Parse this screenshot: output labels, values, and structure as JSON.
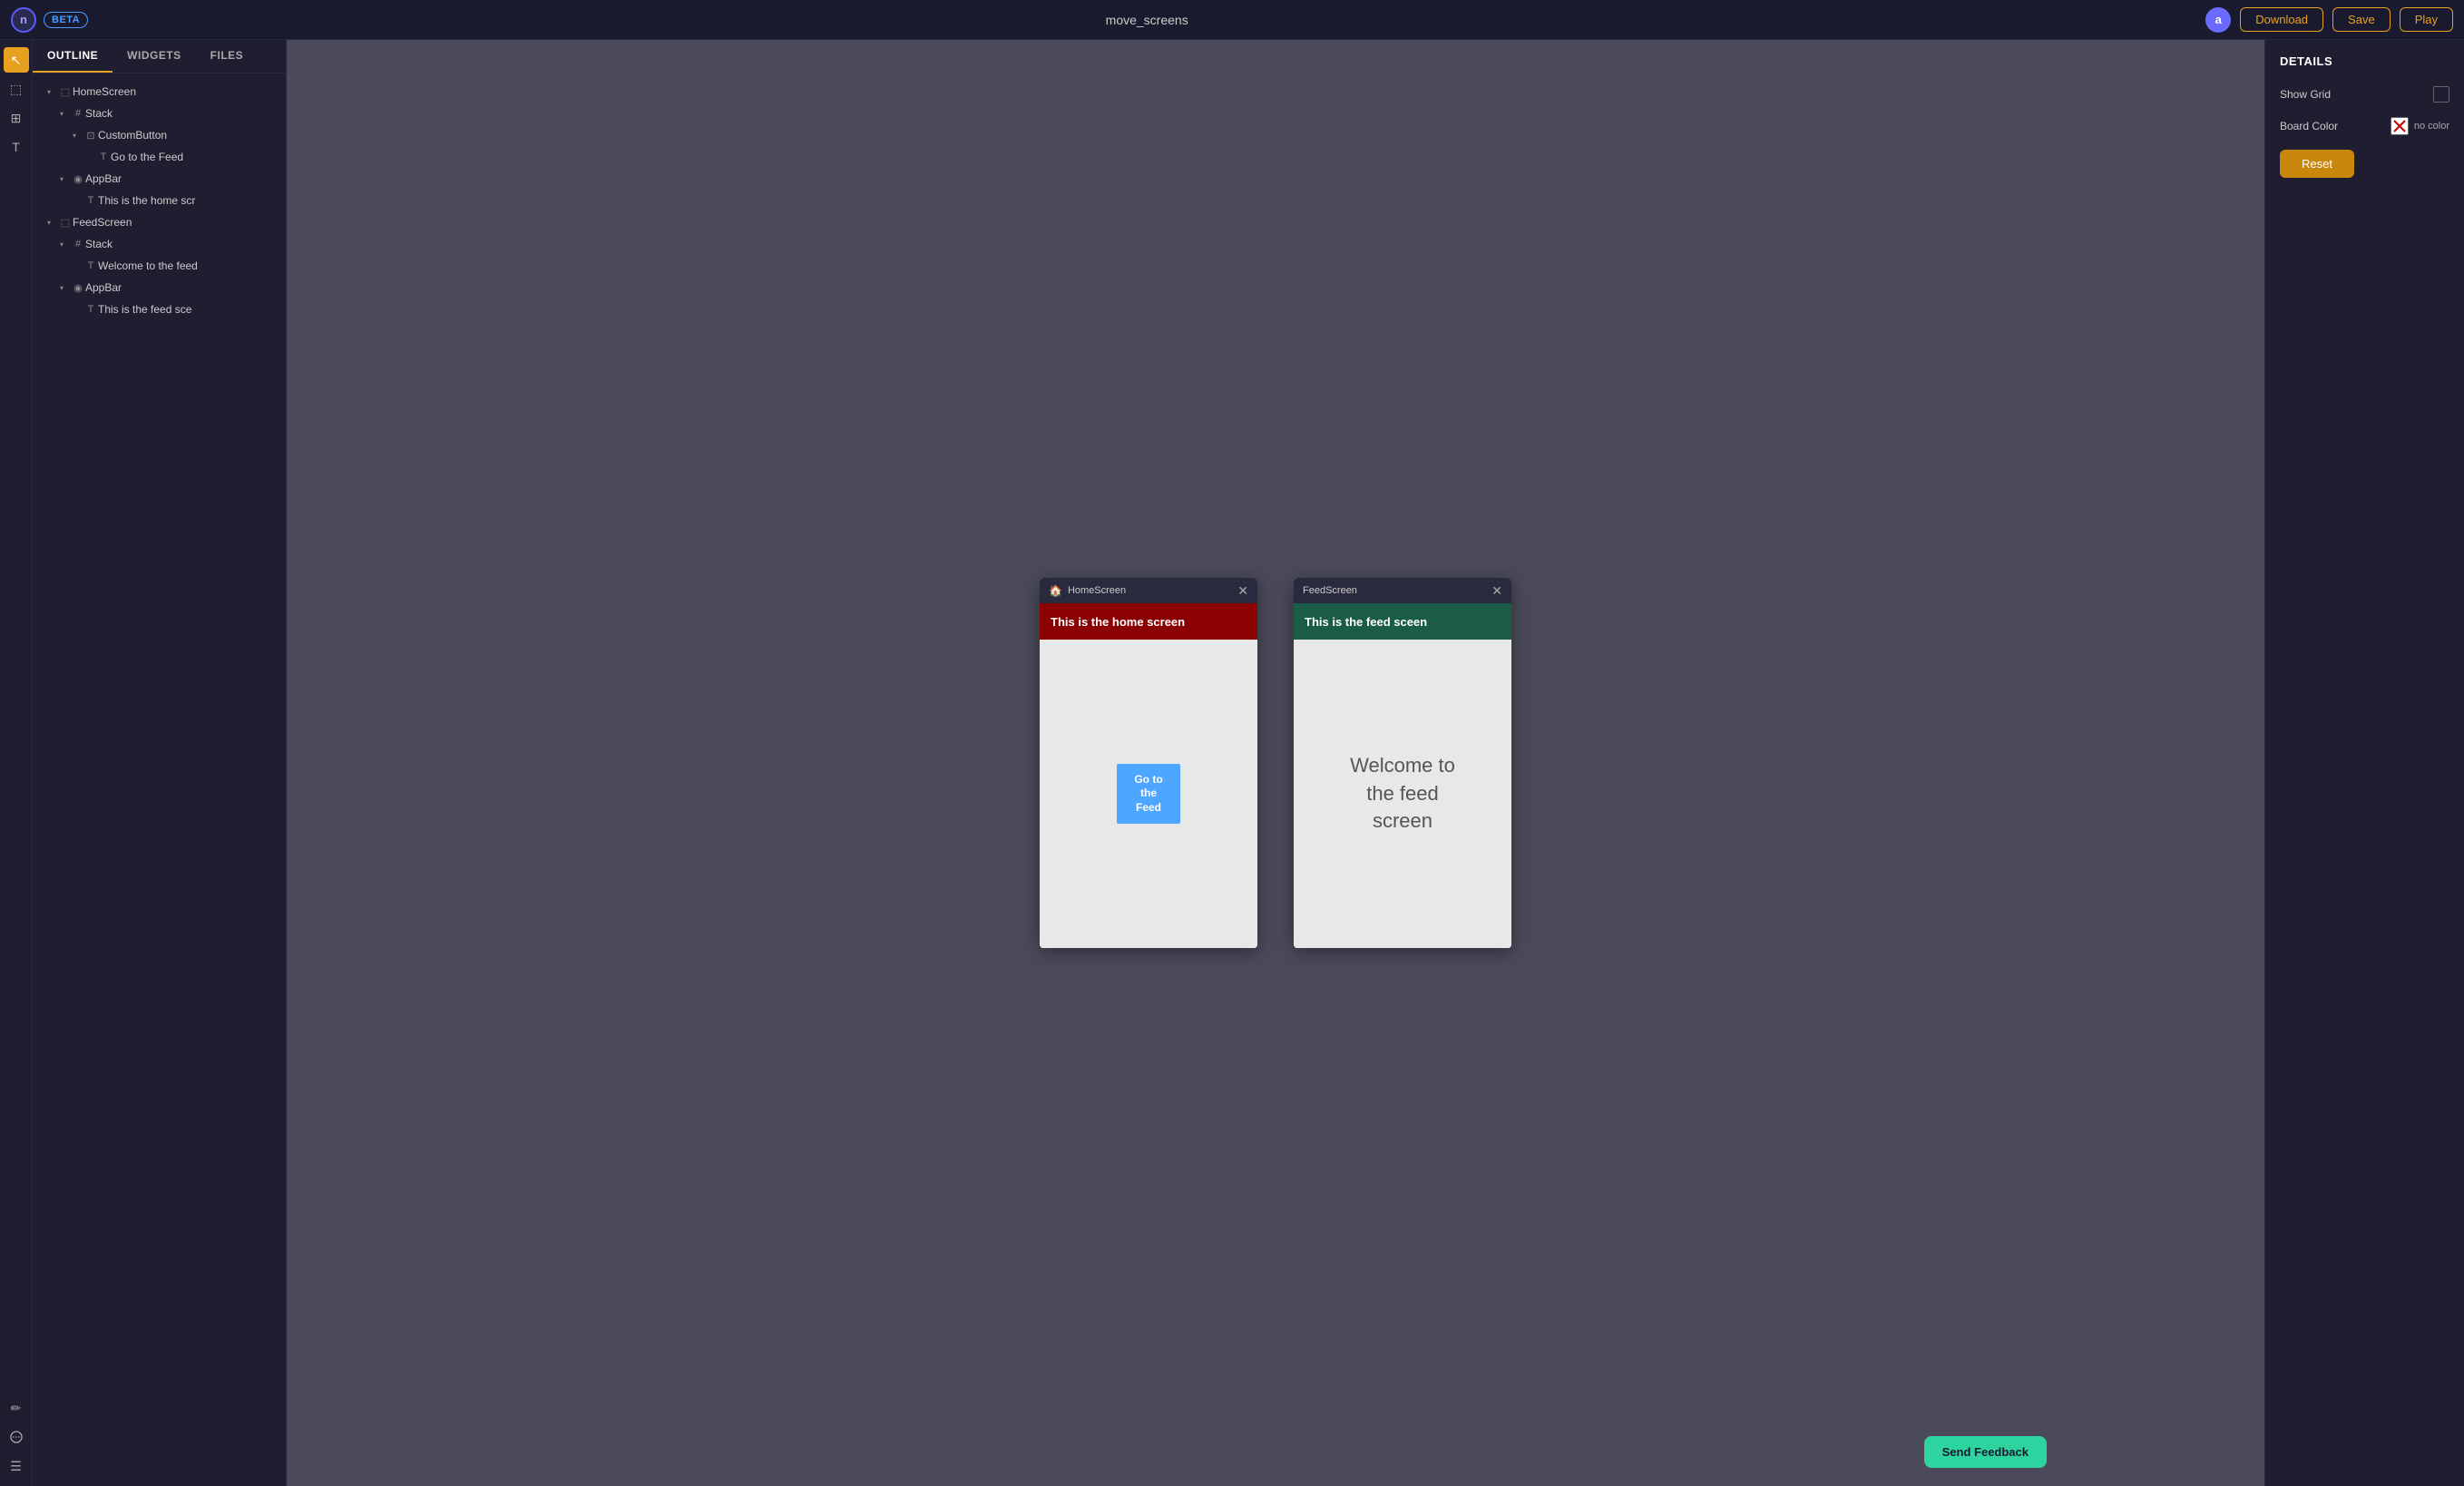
{
  "topbar": {
    "logo_letter": "n",
    "beta_label": "BETA",
    "project_name": "move_screens",
    "avatar_letter": "a",
    "download_label": "Download",
    "save_label": "Save",
    "play_label": "Play"
  },
  "sidebar": {
    "tabs": [
      {
        "id": "outline",
        "label": "OUTLINE"
      },
      {
        "id": "widgets",
        "label": "WIDGETS"
      },
      {
        "id": "files",
        "label": "FILES"
      }
    ],
    "active_tab": "outline",
    "tree": [
      {
        "level": 1,
        "icon": "frame",
        "label": "HomeScreen",
        "arrow": true
      },
      {
        "level": 2,
        "icon": "stack",
        "label": "Stack",
        "arrow": true
      },
      {
        "level": 3,
        "icon": "custom",
        "label": "CustomButton",
        "arrow": true
      },
      {
        "level": 4,
        "icon": "text",
        "label": "Go to the Feed",
        "arrow": false
      },
      {
        "level": 2,
        "icon": "appbar",
        "label": "AppBar",
        "arrow": true
      },
      {
        "level": 3,
        "icon": "text",
        "label": "This is the home scr",
        "arrow": false
      },
      {
        "level": 1,
        "icon": "frame",
        "label": "FeedScreen",
        "arrow": true
      },
      {
        "level": 2,
        "icon": "stack",
        "label": "Stack",
        "arrow": true
      },
      {
        "level": 3,
        "icon": "text",
        "label": "Welcome to the feed",
        "arrow": false
      },
      {
        "level": 2,
        "icon": "appbar",
        "label": "AppBar",
        "arrow": true
      },
      {
        "level": 3,
        "icon": "text",
        "label": "This is the feed sce",
        "arrow": false
      }
    ]
  },
  "canvas": {
    "home_screen": {
      "title": "HomeScreen",
      "appbar_text": "This is the home screen",
      "appbar_color": "#8b0000",
      "button_label": "Go to the Feed",
      "button_color": "#4da6ff"
    },
    "feed_screen": {
      "title": "FeedScreen",
      "appbar_text": "This is the feed sceen",
      "appbar_color": "#1a5c45",
      "welcome_line1": "Welcome to",
      "welcome_line2": "the feed",
      "welcome_line3": "screen"
    }
  },
  "details": {
    "title": "DETAILS",
    "show_grid_label": "Show Grid",
    "board_color_label": "Board Color",
    "no_color_text": "no color",
    "reset_label": "Reset"
  },
  "feedback": {
    "label": "Send Feedback"
  },
  "tools": [
    {
      "name": "cursor",
      "symbol": "↖",
      "active": true
    },
    {
      "name": "frame",
      "symbol": "⬚"
    },
    {
      "name": "layout",
      "symbol": "⊞"
    },
    {
      "name": "text",
      "symbol": "T"
    }
  ],
  "bottom_tools": [
    {
      "name": "pencil",
      "symbol": "✏"
    },
    {
      "name": "chat",
      "symbol": "💬"
    },
    {
      "name": "menu",
      "symbol": "☰"
    }
  ]
}
